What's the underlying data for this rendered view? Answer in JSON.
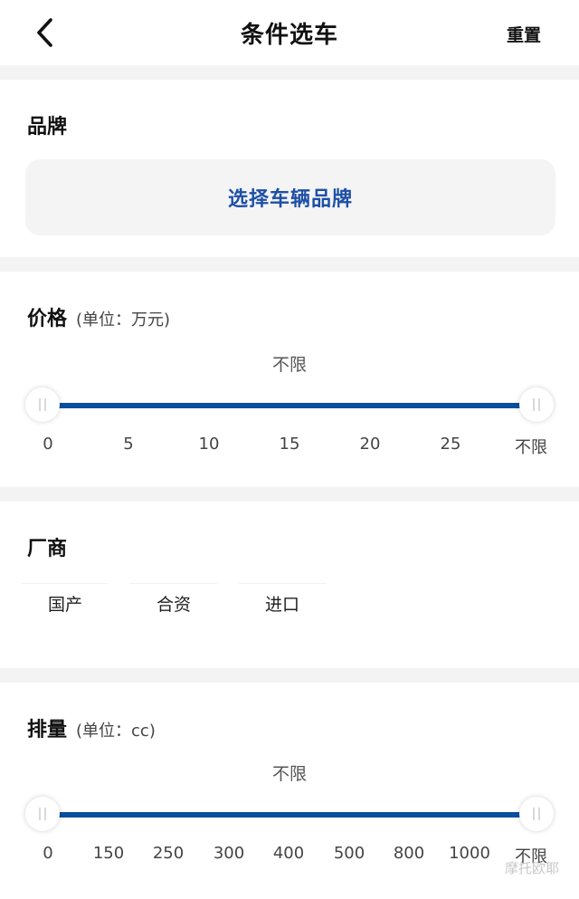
{
  "header": {
    "title": "条件选车",
    "reset_label": "重置"
  },
  "brand": {
    "title": "品牌",
    "select_label": "选择车辆品牌"
  },
  "price": {
    "title": "价格",
    "unit": "(单位：万元)",
    "range_text": "不限",
    "ticks": [
      "0",
      "5",
      "10",
      "15",
      "20",
      "25",
      "不限"
    ]
  },
  "maker": {
    "title": "厂商",
    "options": [
      "国产",
      "合资",
      "进口"
    ]
  },
  "displacement": {
    "title": "排量",
    "unit": "(单位：cc)",
    "range_text": "不限",
    "ticks": [
      "0",
      "150",
      "250",
      "300",
      "400",
      "500",
      "800",
      "1000",
      "不限"
    ]
  },
  "watermark": "摩托欧耶",
  "colors": {
    "accent": "#0a4ea0",
    "link": "#1d4fa6"
  }
}
